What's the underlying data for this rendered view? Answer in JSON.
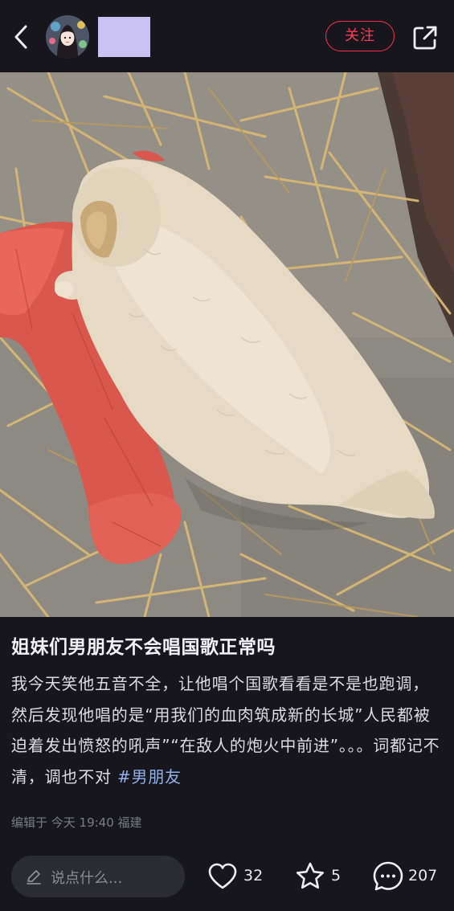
{
  "header": {
    "follow_label": "关注"
  },
  "post": {
    "title": "姐妹们男朋友不会唱国歌正常吗",
    "body": "我今天笑他五音不全，让他唱个国歌看看是不是也跑调，然后发现他唱的是“用我们的血肉筑成新的长城”人民都被迫着发出愤怒的吼声”“在敌人的炮火中前进”。。。词都记不清，调也不对 ",
    "hashtag": "#男朋友",
    "meta": "编辑于 今天 19:40 福建"
  },
  "bottom_bar": {
    "comment_placeholder": "说点什么...",
    "likes": "32",
    "favorites": "5",
    "comments": "207"
  },
  "colors": {
    "background": "#16161c",
    "accent": "#ff2d4b",
    "hashtag": "#8fb3ee",
    "placeholder_block": "#c8c1f1"
  }
}
